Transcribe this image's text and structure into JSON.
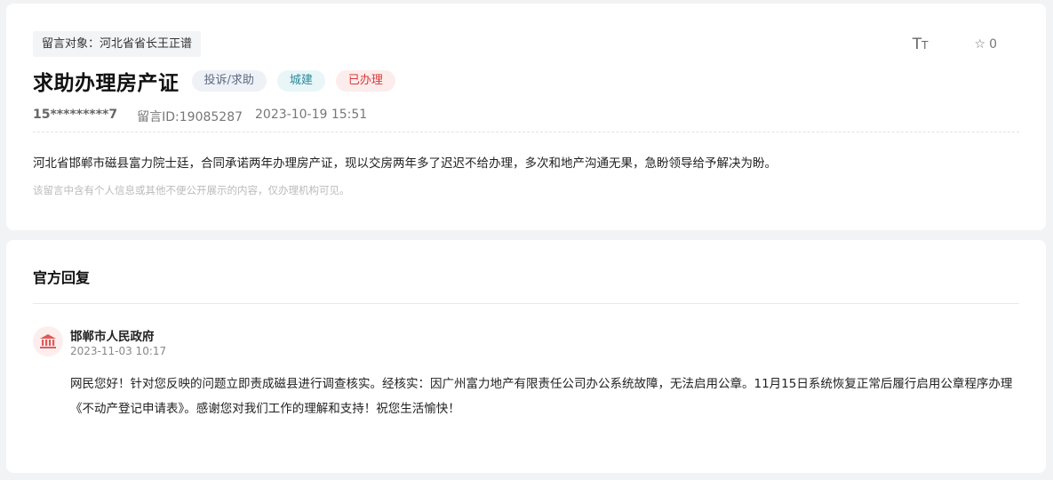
{
  "message": {
    "target_tag": "留言对象：河北省省长王正谱",
    "title": "求助办理房产证",
    "tags": {
      "type": "投诉/求助",
      "category": "城建",
      "status": "已办理"
    },
    "toolbar": {
      "font_size_label": "Tт",
      "favorite_icon": "star-outline-icon",
      "favorite_count": "0"
    },
    "meta": {
      "user": "15*********7",
      "message_id": "留言ID:19085287",
      "time": "2023-10-19 15:51"
    },
    "content": "河北省邯郸市磁县富力院士廷，合同承诺两年办理房产证，现以交房两年多了迟迟不给办理，多次和地产沟通无果，急盼领导给予解决为盼。",
    "privacy_note": "该留言中含有个人信息或其他不便公开展示的内容，仅办理机构可见。"
  },
  "reply": {
    "section_title": "官方回复",
    "avatar_icon": "government-building-icon",
    "org_name": "邯郸市人民政府",
    "time": "2023-11-03 10:17",
    "text": "网民您好！针对您反映的问题立即责成磁县进行调查核实。经核实：因广州富力地产有限责任公司办公系统故障，无法启用公章。11月15日系统恢复正常后履行启用公章程序办理《不动产登记申请表》。感谢您对我们工作的理解和支持！祝您生活愉快！"
  },
  "colors": {
    "page_bg": "#f2f3f5",
    "status_red": "#d83a3a",
    "category_teal": "#2d8a9b",
    "type_gray": "#5f6b84",
    "avatar_red": "#e05a5a"
  }
}
